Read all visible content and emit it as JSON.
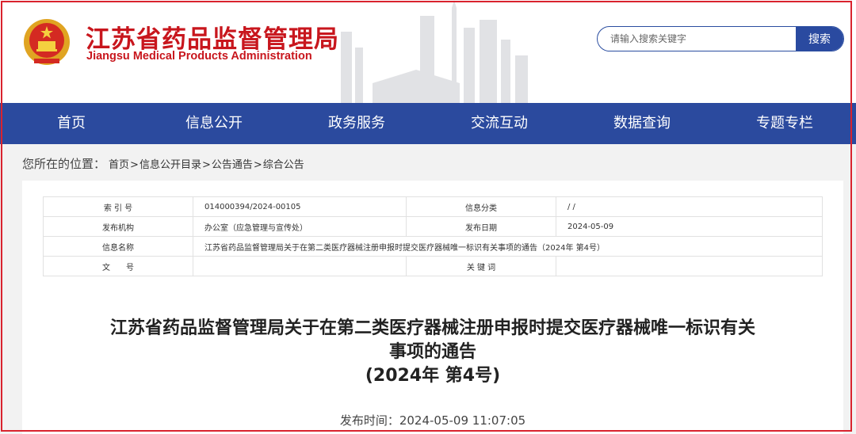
{
  "header": {
    "title_cn": "江苏省药品监督管理局",
    "title_en": "Jiangsu Medical Products Administration",
    "emblem_icon": "national-emblem-icon"
  },
  "search": {
    "placeholder": "请输入搜索关键字",
    "button": "搜索"
  },
  "nav": {
    "items": [
      "首页",
      "信息公开",
      "政务服务",
      "交流互动",
      "数据查询",
      "专题专栏"
    ]
  },
  "breadcrumb": {
    "label": "您所在的位置：",
    "items": [
      "首页",
      "信息公开目录",
      "公告通告",
      "综合公告"
    ],
    "separator": ">"
  },
  "meta": {
    "index_label": "索 引 号",
    "index_value": "014000394/2024-00105",
    "category_label": "信息分类",
    "category_value": "/   /",
    "org_label": "发布机构",
    "org_value": "办公室（应急管理与宣传处）",
    "date_label": "发布日期",
    "date_value": "2024-05-09",
    "name_label": "信息名称",
    "name_value": "江苏省药品监督管理局关于在第二类医疗器械注册申报时提交医疗器械唯一标识有关事项的通告（2024年 第4号）",
    "docno_label": "文　　号",
    "docno_value": "",
    "keyword_label": "关 键 词",
    "keyword_value": ""
  },
  "article": {
    "title_line1": "江苏省药品监督管理局关于在第二类医疗器械注册申报时提交医疗器械唯一标识有关",
    "title_line2": "事项的通告",
    "title_line3": "(2024年 第4号)",
    "pubtime": "发布时间：2024-05-09 11:07:05"
  },
  "colors": {
    "brand_red": "#c8161d",
    "nav_blue": "#2b4a9e",
    "frame_red": "#d9232e"
  }
}
